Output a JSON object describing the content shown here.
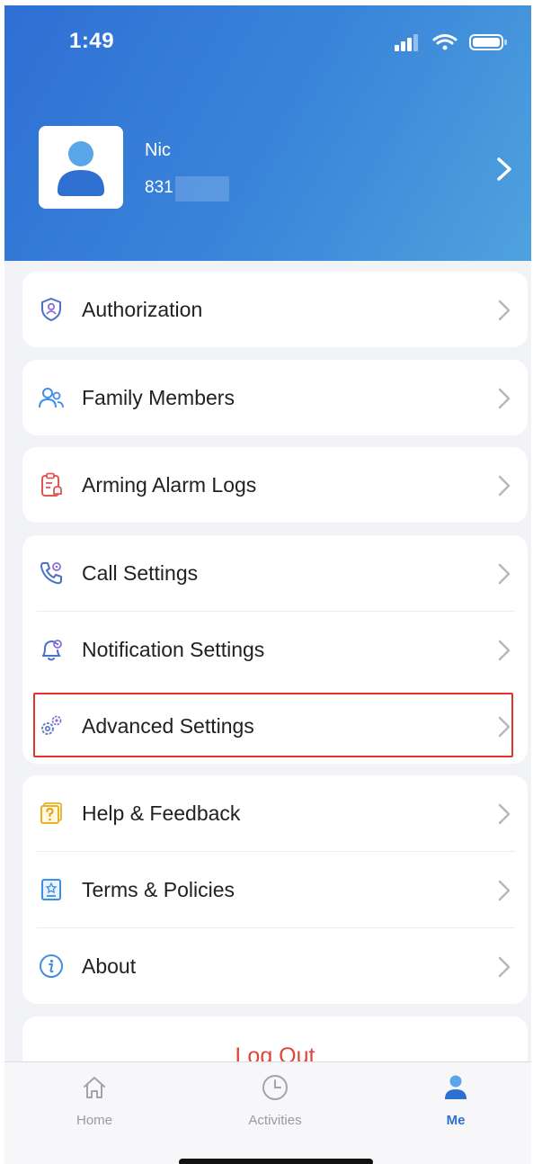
{
  "status_bar": {
    "time": "1:49",
    "icons": [
      "signal-icon",
      "wifi-icon",
      "battery-icon"
    ]
  },
  "profile": {
    "name": "Nic",
    "id_prefix": "831",
    "avatar_icon": "user-avatar-icon"
  },
  "menu": {
    "authorization": {
      "label": "Authorization",
      "icon": "shield-user-icon"
    },
    "family_members": {
      "label": "Family Members",
      "icon": "users-icon"
    },
    "arming_alarm_logs": {
      "label": "Arming Alarm Logs",
      "icon": "clipboard-alarm-icon"
    },
    "call_settings": {
      "label": "Call Settings",
      "icon": "phone-gear-icon"
    },
    "notification_settings": {
      "label": "Notification Settings",
      "icon": "bell-gear-icon"
    },
    "advanced_settings": {
      "label": "Advanced Settings",
      "icon": "gears-icon"
    },
    "help_feedback": {
      "label": "Help & Feedback",
      "icon": "help-icon"
    },
    "terms_policies": {
      "label": "Terms & Policies",
      "icon": "document-icon"
    },
    "about": {
      "label": "About",
      "icon": "info-icon"
    }
  },
  "logout": {
    "label": "Log Out"
  },
  "tabbar": {
    "home": {
      "label": "Home",
      "icon": "home-icon"
    },
    "activities": {
      "label": "Activities",
      "icon": "clock-icon"
    },
    "me": {
      "label": "Me",
      "icon": "person-icon"
    }
  },
  "colors": {
    "accent": "#2e6fd2",
    "header_start": "#2f6fd4",
    "header_end": "#4fa2de",
    "highlight": "#e5312b",
    "logout": "#e0443c"
  }
}
